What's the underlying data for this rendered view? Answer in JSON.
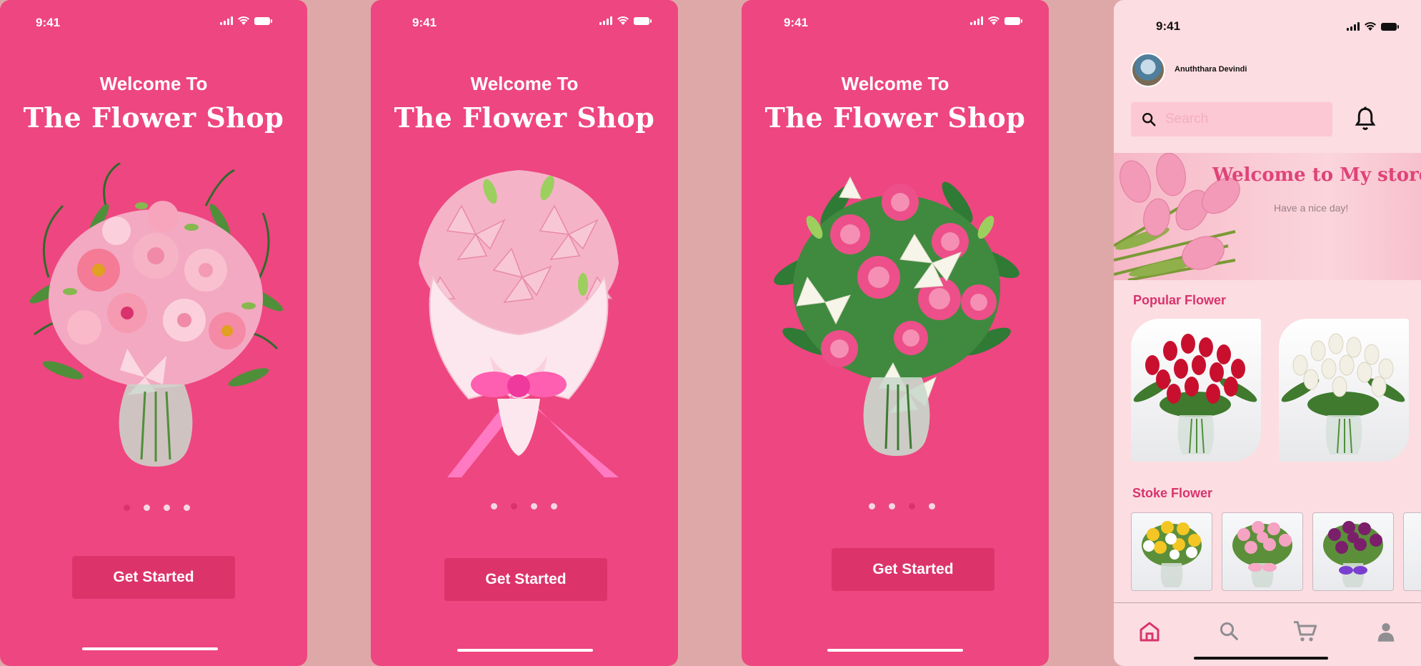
{
  "onboarding": [
    {
      "time": "9:41",
      "welcome": "Welcome To",
      "title": "The Flower Shop",
      "button": "Get Started",
      "active_dot": 0
    },
    {
      "time": "9:41",
      "welcome": "Welcome To",
      "title": "The Flower Shop",
      "button": "Get Started",
      "active_dot": 1
    },
    {
      "time": "9:41",
      "welcome": "Welcome To",
      "title": "The Flower Shop",
      "button": "Get Started",
      "active_dot": 2
    }
  ],
  "store": {
    "time": "9:41",
    "user_name": "Anuththara Devindi",
    "search_placeholder": "Search",
    "banner": {
      "title": "Welcome to My store",
      "subtitle": "Have a nice day!"
    },
    "popular_title": "Popular Flower",
    "popular_items": [
      {
        "icon": "red-tulips-image",
        "flower_color": "#c8102e"
      },
      {
        "icon": "white-tulips-image",
        "flower_color": "#f2efe4"
      }
    ],
    "stock_title": "Stoke Flower",
    "stock_items": [
      {
        "icon": "yellow-tulips-image",
        "flower_color": "#f3c623"
      },
      {
        "icon": "pink-tulips-image",
        "flower_color": "#f5a3c2"
      },
      {
        "icon": "purple-tulips-image",
        "flower_color": "#7b1f6b"
      }
    ],
    "nav": [
      "home-icon",
      "search-icon",
      "cart-icon",
      "profile-icon"
    ]
  },
  "colors": {
    "screen_pink": "#ee4680",
    "button_pink": "#dc336b",
    "store_bg": "#fcdde2",
    "accent": "#d8336d",
    "backdrop": "#dfa8a8"
  }
}
